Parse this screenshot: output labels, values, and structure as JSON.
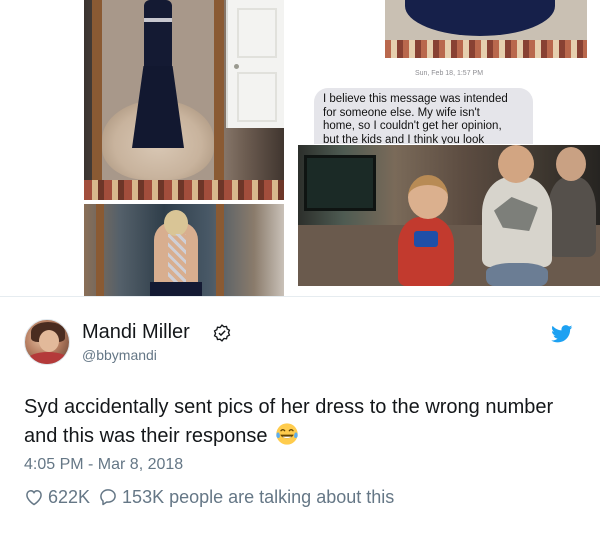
{
  "message": {
    "timestamp": "Sun, Feb 18, 1:57 PM",
    "lines": [
      "I believe this message was intended",
      "for someone else. My wife isn't",
      "home, so I couldn't get her opinion,",
      "but the kids and I think you look"
    ]
  },
  "tweet": {
    "author_name": "Mandi Miller",
    "author_handle": "@bbymandi",
    "text": "Syd accidentally sent pics of her dress to the wrong number and this was their response",
    "date": "4:05 PM - Mar 8, 2018",
    "likes": "622K",
    "replies_text": "153K people are talking about this",
    "brand_color": "#1da1f2",
    "icons": {
      "verified": "verified-badge-icon",
      "brand": "twitter-bird-icon",
      "emoji": "tears-of-joy-emoji",
      "like": "heart-icon",
      "reply": "speech-bubble-icon"
    }
  }
}
